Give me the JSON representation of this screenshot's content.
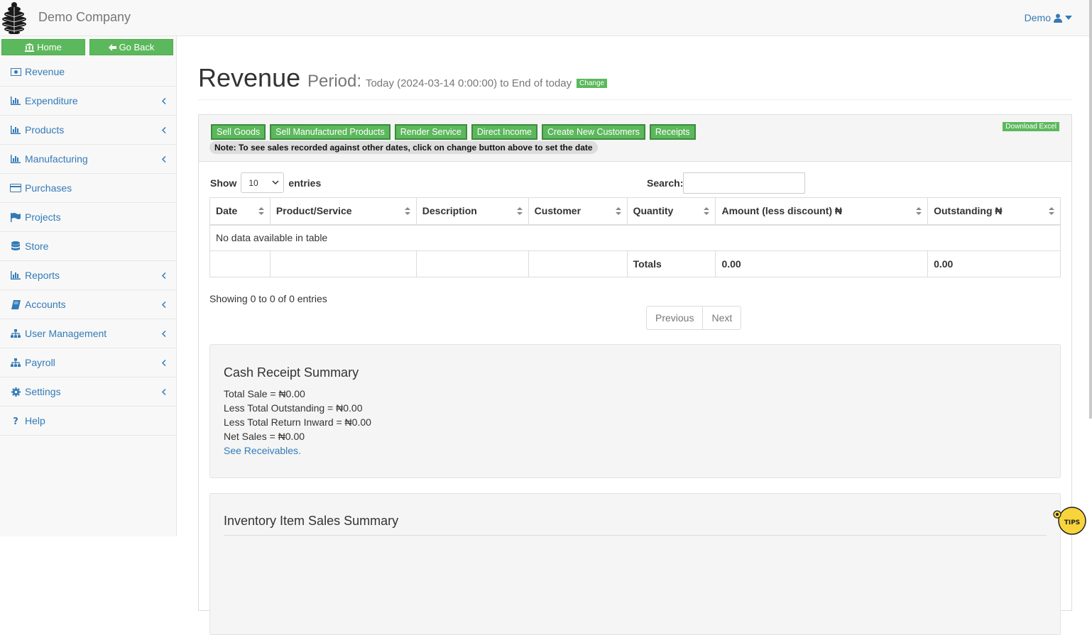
{
  "app": {
    "company": "Demo Company",
    "user": "Demo"
  },
  "sidebar": {
    "home_label": "Home",
    "back_label": "Go Back",
    "items": [
      {
        "label": "Revenue",
        "icon": "money-icon",
        "chevron": false
      },
      {
        "label": "Expenditure",
        "icon": "bar-chart-icon",
        "chevron": true
      },
      {
        "label": "Products",
        "icon": "bar-chart-icon",
        "chevron": true
      },
      {
        "label": "Manufacturing",
        "icon": "bar-chart-icon",
        "chevron": true
      },
      {
        "label": "Purchases",
        "icon": "credit-card-icon",
        "chevron": false
      },
      {
        "label": "Projects",
        "icon": "flag-icon",
        "chevron": false
      },
      {
        "label": "Store",
        "icon": "database-icon",
        "chevron": false
      },
      {
        "label": "Reports",
        "icon": "bar-chart-icon",
        "chevron": true
      },
      {
        "label": "Accounts",
        "icon": "book-icon",
        "chevron": true
      },
      {
        "label": "User Management",
        "icon": "sitemap-icon",
        "chevron": true
      },
      {
        "label": "Payroll",
        "icon": "sitemap-icon",
        "chevron": true
      },
      {
        "label": "Settings",
        "icon": "gear-icon",
        "chevron": true
      },
      {
        "label": "Help",
        "icon": "question-icon",
        "chevron": false
      }
    ]
  },
  "header": {
    "title": "Revenue",
    "period_label": "Period:",
    "period_text": "Today (2024-03-14 0:00:00) to End of today",
    "change_label": "Change"
  },
  "toolbar": {
    "buttons": [
      "Sell Goods",
      "Sell Manufactured Products",
      "Render Service",
      "Direct Income",
      "Create New Customers",
      "Receipts"
    ],
    "note": "Note: To see sales recorded against other dates, click on change button above to set the date",
    "download_label": "Download Excel"
  },
  "table": {
    "show_label": "Show",
    "entries_label": "entries",
    "page_size": "10",
    "search_label": "Search:",
    "search_value": "",
    "columns": [
      "Date",
      "Product/Service",
      "Description",
      "Customer",
      "Quantity",
      "Amount (less discount) ₦",
      "Outstanding ₦"
    ],
    "empty_message": "No data available in table",
    "totals_label": "Totals",
    "total_amount": "0.00",
    "total_outstanding": "0.00",
    "info": "Showing 0 to 0 of 0 entries",
    "prev_label": "Previous",
    "next_label": "Next"
  },
  "cash_summary": {
    "title": "Cash Receipt Summary",
    "total_sale": "Total Sale = ₦0.00",
    "less_outstanding": "Less Total Outstanding = ₦0.00",
    "less_return": "Less Total Return Inward = ₦0.00",
    "net_sales": "Net Sales = ₦0.00",
    "link": "See Receivables."
  },
  "inventory_summary": {
    "title": "Inventory Item Sales Summary"
  },
  "colors": {
    "accent_green": "#5cb85c",
    "link_blue": "#337ab7"
  }
}
